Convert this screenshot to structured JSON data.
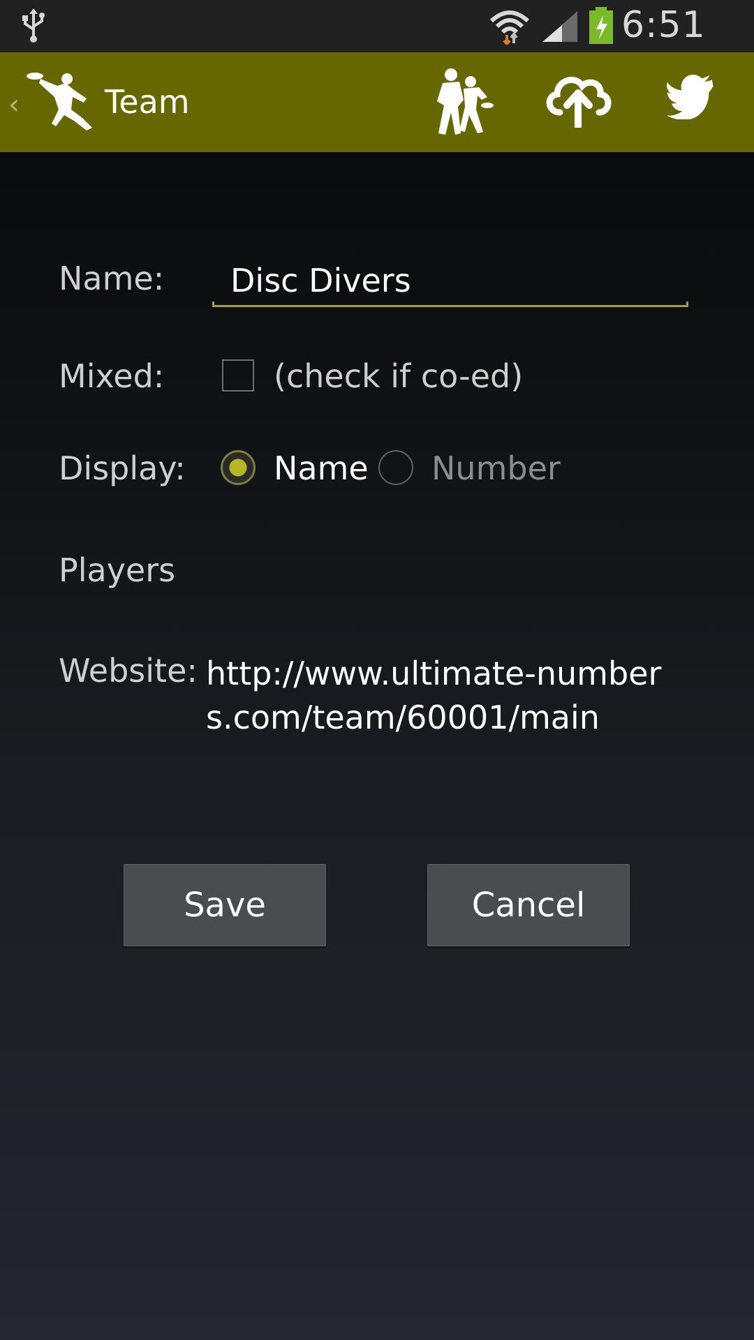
{
  "status_bar": {
    "time": "6:51 PM",
    "icons": [
      "usb-icon",
      "wifi-icon",
      "signal-icon",
      "battery-charging-icon"
    ]
  },
  "action_bar": {
    "back_glyph": "‹",
    "title": "Team",
    "icons": [
      "ultimate-player-logo-icon",
      "players-icon",
      "cloud-upload-icon",
      "twitter-icon"
    ],
    "accent_color": "#676700"
  },
  "form": {
    "name_label": "Name:",
    "name_value": "Disc Divers",
    "mixed_label": "Mixed:",
    "mixed_checked": false,
    "mixed_hint": "(check if co-ed)",
    "display_label": "Display:",
    "display_options": [
      "Name",
      "Number"
    ],
    "display_selected": "Name",
    "players_label": "Players",
    "website_label": "Website:",
    "website_url": "http://www.ultimate-numbers.com/team/60001/main"
  },
  "buttons": {
    "save": "Save",
    "cancel": "Cancel"
  }
}
